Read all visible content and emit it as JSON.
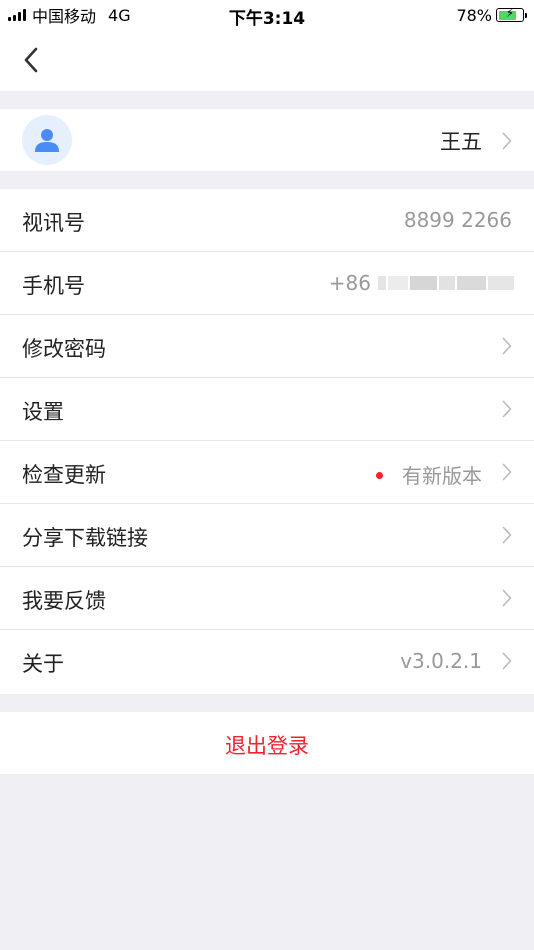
{
  "status_bar": {
    "carrier": "中国移动",
    "network": "4G",
    "time": "下午3:14",
    "battery": "78%",
    "battery_level": 0.78
  },
  "nav": {
    "back_icon": "chevron-left-icon"
  },
  "profile": {
    "name": "王五",
    "avatar_icon": "user-icon"
  },
  "rows": [
    {
      "label": "视讯号",
      "value": "8899 2266"
    },
    {
      "label": "手机号",
      "value": "+86"
    },
    {
      "label": "修改密码"
    },
    {
      "label": "设置"
    },
    {
      "label": "检查更新",
      "value": "有新版本"
    },
    {
      "label": "分享下载链接"
    },
    {
      "label": "我要反馈"
    },
    {
      "label": "关于",
      "value": "v3.0.2.1"
    }
  ],
  "logout": {
    "label": "退出登录"
  },
  "colors": {
    "accent_red": "#f5222d",
    "avatar_blue": "#4a8cf7",
    "background": "#efeff4"
  }
}
